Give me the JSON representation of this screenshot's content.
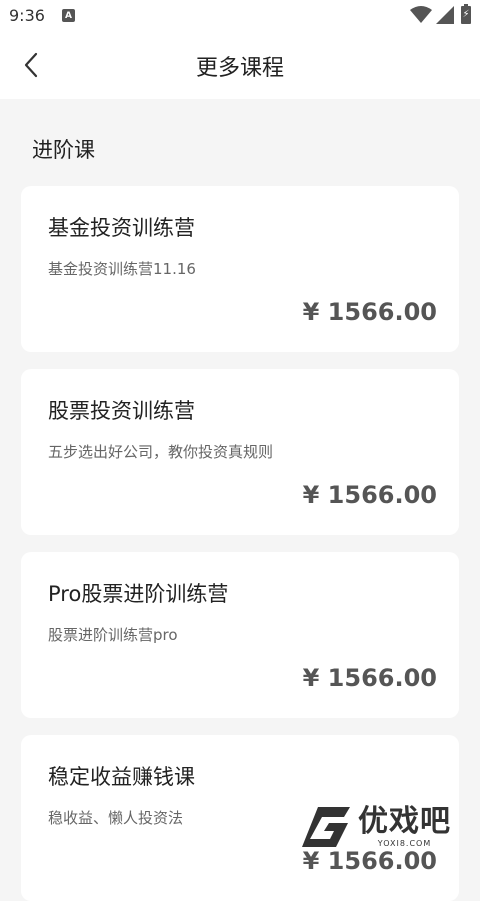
{
  "status_bar": {
    "time": "9:36",
    "notification_icon_letter": "A"
  },
  "header": {
    "title": "更多课程",
    "back_icon": "chevron-left-icon"
  },
  "section": {
    "title": "进阶课"
  },
  "courses": [
    {
      "title": "基金投资训练营",
      "description": "基金投资训练营11.16",
      "price": "¥ 1566.00"
    },
    {
      "title": "股票投资训练营",
      "description": "五步选出好公司，教你投资真规则",
      "price": "¥ 1566.00"
    },
    {
      "title": "Pro股票进阶训练营",
      "description": "股票进阶训练营pro",
      "price": "¥ 1566.00"
    },
    {
      "title": "稳定收益赚钱课",
      "description": "稳收益、懒人投资法",
      "price": "¥ 1566.00"
    }
  ],
  "watermark": {
    "text": "优戏吧",
    "url": "YOXI8.COM"
  },
  "colors": {
    "background": "#f5f5f5",
    "card": "#ffffff",
    "title_text": "#222222",
    "desc_text": "#666666",
    "price_text": "#555555"
  }
}
